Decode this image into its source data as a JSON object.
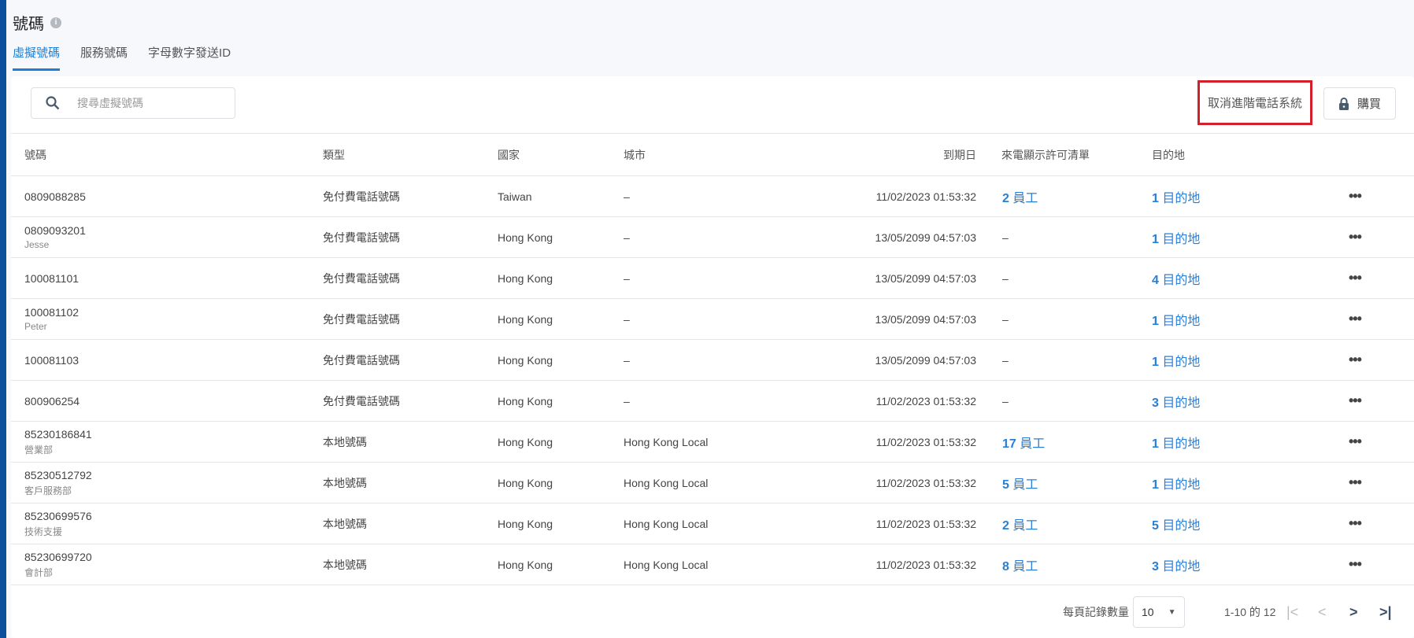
{
  "page": {
    "title": "號碼",
    "info_icon": "i"
  },
  "tabs": [
    {
      "label": "虛擬號碼"
    },
    {
      "label": "服務號碼"
    },
    {
      "label": "字母數字發送ID"
    }
  ],
  "search": {
    "placeholder": "搜尋虛擬號碼"
  },
  "toolbar": {
    "cancel_label": "取消進階電話系統",
    "buy_label": "購買"
  },
  "columns": [
    "號碼",
    "類型",
    "國家",
    "城市",
    "到期日",
    "來電顯示許可清單",
    "目的地"
  ],
  "rows": [
    {
      "number": "0809088285",
      "sub": "",
      "type": "免付費電話號碼",
      "country": "Taiwan",
      "city": "–",
      "expiry": "11/02/2023 01:53:32",
      "allow_n": "2",
      "allow_unit": "員工",
      "dest_n": "1",
      "dest_unit": "目的地"
    },
    {
      "number": "0809093201",
      "sub": "Jesse",
      "type": "免付費電話號碼",
      "country": "Hong Kong",
      "city": "–",
      "expiry": "13/05/2099 04:57:03",
      "allow_text": "–",
      "dest_n": "1",
      "dest_unit": "目的地"
    },
    {
      "number": "100081101",
      "sub": "",
      "type": "免付費電話號碼",
      "country": "Hong Kong",
      "city": "–",
      "expiry": "13/05/2099 04:57:03",
      "allow_text": "–",
      "dest_n": "4",
      "dest_unit": "目的地"
    },
    {
      "number": "100081102",
      "sub": "Peter",
      "type": "免付費電話號碼",
      "country": "Hong Kong",
      "city": "–",
      "expiry": "13/05/2099 04:57:03",
      "allow_text": "–",
      "dest_n": "1",
      "dest_unit": "目的地"
    },
    {
      "number": "100081103",
      "sub": "",
      "type": "免付費電話號碼",
      "country": "Hong Kong",
      "city": "–",
      "expiry": "13/05/2099 04:57:03",
      "allow_text": "–",
      "dest_n": "1",
      "dest_unit": "目的地"
    },
    {
      "number": "800906254",
      "sub": "",
      "type": "免付費電話號碼",
      "country": "Hong Kong",
      "city": "–",
      "expiry": "11/02/2023 01:53:32",
      "allow_text": "–",
      "dest_n": "3",
      "dest_unit": "目的地"
    },
    {
      "number": "85230186841",
      "sub": "營業部",
      "type": "本地號碼",
      "country": "Hong Kong",
      "city": "Hong Kong Local",
      "expiry": "11/02/2023 01:53:32",
      "allow_n": "17",
      "allow_unit": "員工",
      "dest_n": "1",
      "dest_unit": "目的地"
    },
    {
      "number": "85230512792",
      "sub": "客戶服務部",
      "type": "本地號碼",
      "country": "Hong Kong",
      "city": "Hong Kong Local",
      "expiry": "11/02/2023 01:53:32",
      "allow_n": "5",
      "allow_unit": "員工",
      "dest_n": "1",
      "dest_unit": "目的地"
    },
    {
      "number": "85230699576",
      "sub": "技術支援",
      "type": "本地號碼",
      "country": "Hong Kong",
      "city": "Hong Kong Local",
      "expiry": "11/02/2023 01:53:32",
      "allow_n": "2",
      "allow_unit": "員工",
      "dest_n": "5",
      "dest_unit": "目的地"
    },
    {
      "number": "85230699720",
      "sub": "會計部",
      "type": "本地號碼",
      "country": "Hong Kong",
      "city": "Hong Kong Local",
      "expiry": "11/02/2023 01:53:32",
      "allow_n": "8",
      "allow_unit": "員工",
      "dest_n": "3",
      "dest_unit": "目的地"
    }
  ],
  "pagination": {
    "per_page_label": "每頁記錄數量",
    "per_page_value": "10",
    "range": "1-10 的 12"
  }
}
